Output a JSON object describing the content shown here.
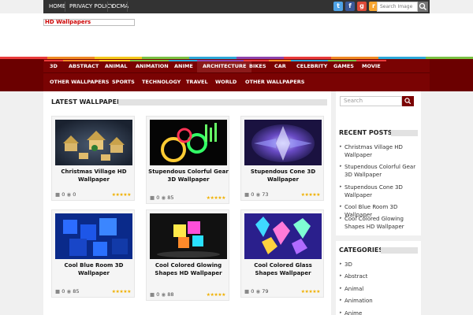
{
  "topbar": {
    "links": [
      {
        "label": "HOME"
      },
      {
        "label": "PRIVACY POLICY"
      },
      {
        "label": "DCMA"
      }
    ],
    "social": [
      {
        "icon": "twitter-icon",
        "glyph": "t",
        "color": "#4fa3e6"
      },
      {
        "icon": "facebook-icon",
        "glyph": "f",
        "color": "#3b5998"
      },
      {
        "icon": "google-plus-icon",
        "glyph": "g",
        "color": "#dd4b39"
      },
      {
        "icon": "rss-icon",
        "glyph": "r",
        "color": "#f7a530"
      }
    ],
    "search_placeholder": "Search Image"
  },
  "logo": "HD Wallpapers",
  "nav": {
    "row1": [
      "3D",
      "ABSTRACT",
      "ANIMAL",
      "ANIMATION",
      "ANIME",
      "ARCHITECTURE",
      "BIKES",
      "CAR",
      "CELEBRITY",
      "GAMES",
      "MOVIE"
    ],
    "row2": [
      "OTHER WALLPAPERS",
      "SPORTS",
      "TECHNOLOGY",
      "TRAVEL",
      "WORLD",
      "OTHER WALLPAPERS"
    ],
    "active": "ARCHITECTURE"
  },
  "colors": {
    "brand": "#7a0303",
    "stripe": [
      "#e93b3b",
      "#f08a24",
      "#f5c91c",
      "#7ac142",
      "#2ca7d8",
      "#8e44ad",
      "#e93b3b",
      "#f08a24",
      "#2ca7d8",
      "#7ac142"
    ]
  },
  "main": {
    "section_title": "LATEST WALLPAPER",
    "cards": [
      {
        "title": "Christmas Village HD Wallpaper",
        "comments": "0",
        "views": "0"
      },
      {
        "title": "Stupendous Colorful Gear 3D Wallpaper",
        "comments": "0",
        "views": "85"
      },
      {
        "title": "Stupendous Cone 3D Wallpaper",
        "comments": "0",
        "views": "73"
      },
      {
        "title": "Cool Blue Room 3D Wallpaper",
        "comments": "0",
        "views": "85"
      },
      {
        "title": "Cool Colored Glowing Shapes HD Wallpaper",
        "comments": "0",
        "views": "88"
      },
      {
        "title": "Cool Colored Glass Shapes Wallpaper",
        "comments": "0",
        "views": "79"
      }
    ],
    "stars": "★★★★★"
  },
  "sidebar": {
    "search_placeholder": "Search",
    "recent_title": "RECENT POSTS",
    "recent": [
      "Christmas Village HD Wallpaper",
      "Stupendous Colorful Gear 3D Wallpaper",
      "Stupendous Cone 3D Wallpaper",
      "Cool Blue Room 3D Wallpaper",
      "Cool Colored Glowing Shapes HD Wallpaper"
    ],
    "categories_title": "CATEGORIES",
    "categories": [
      "3D",
      "Abstract",
      "Animal",
      "Animation",
      "Anime"
    ]
  }
}
